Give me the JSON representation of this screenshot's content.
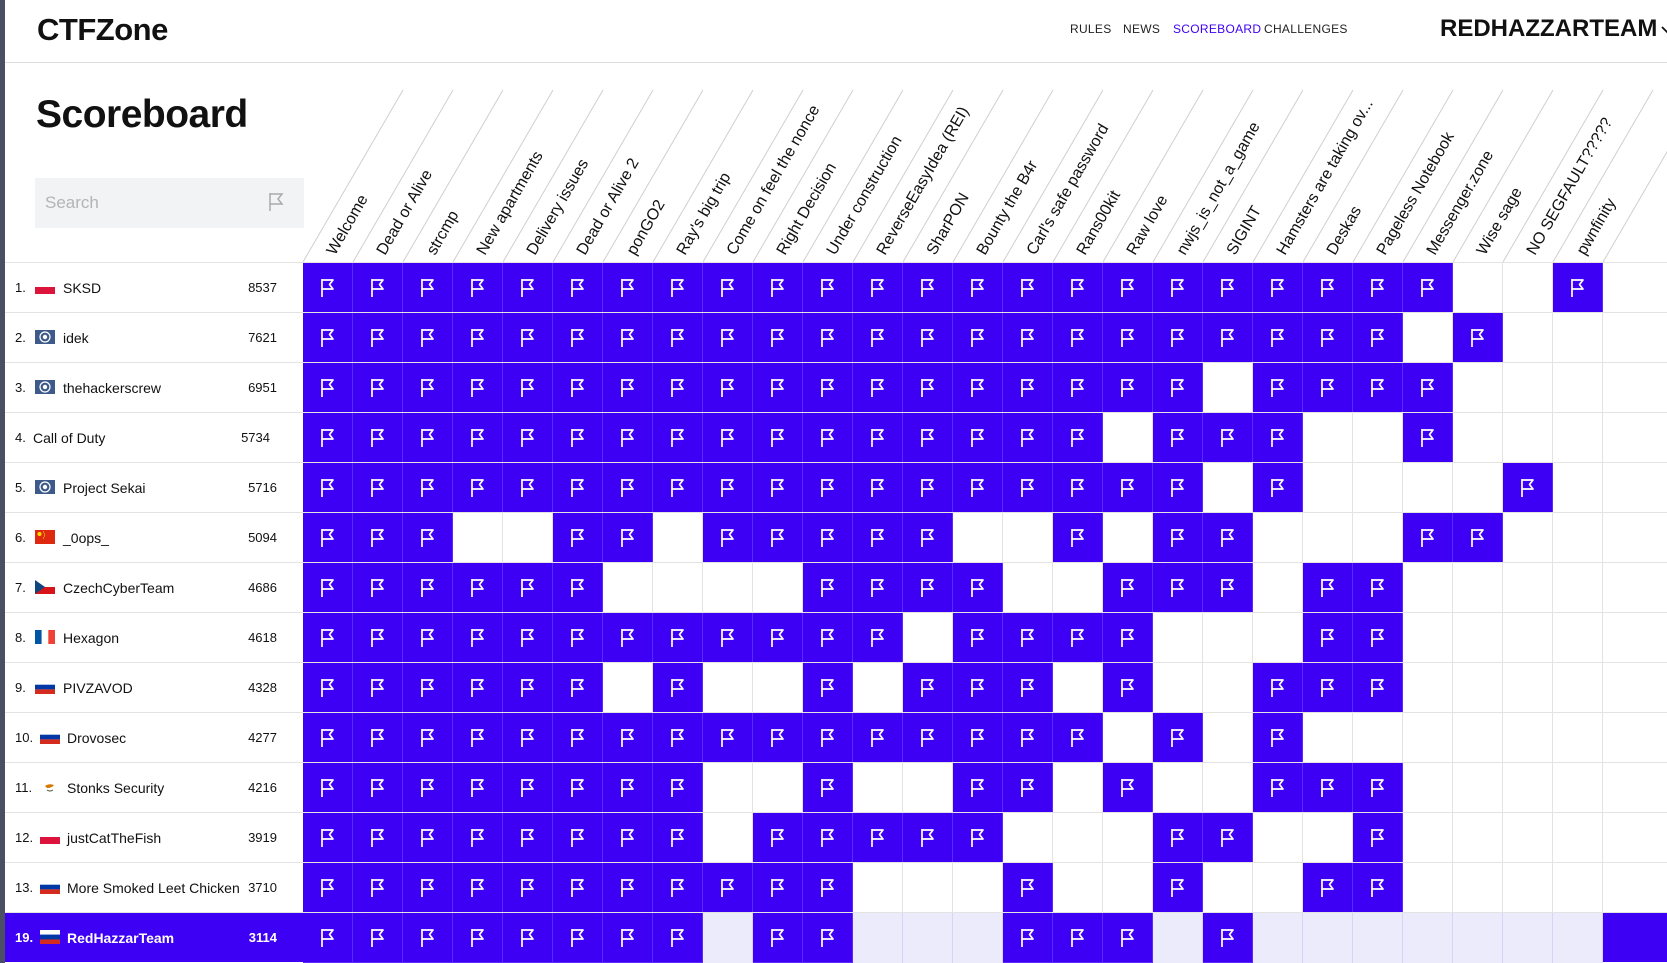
{
  "app": {
    "logo": "CTFZone"
  },
  "nav": {
    "links": [
      "RULES",
      "NEWS",
      "SCOREBOARD",
      "CHALLENGES"
    ],
    "active": "SCOREBOARD",
    "team_menu": "REDHAZZARTEAM"
  },
  "page": {
    "title": "Scoreboard"
  },
  "search": {
    "placeholder": "Search",
    "value": "",
    "icon": "flag-icon"
  },
  "colors": {
    "accent": "#3d00f5",
    "current_row_empty": "#ecebfb"
  },
  "challenges": [
    "Welcome",
    "Dead or Alive",
    "strcmp",
    "New apartments",
    "Delivery issues",
    "Dead or Alive 2",
    "ponGO2",
    "Ray's big trip",
    "Come on feel the nonce",
    "Right Decision",
    "Under construction",
    "ReverseEasyIdea (REI)",
    "SharPON",
    "Bounty the B4r",
    "Carl's safe password",
    "Rans00kit",
    "Raw love",
    "nwjs_is_not_a_game",
    "SIGINT",
    "Hamsters are taking ov...",
    "Deskas",
    "Pageless Notebook",
    "Messenger.zone",
    "Wise sage",
    "NO SEGFAULT?????",
    "pwnfinity"
  ],
  "teams": [
    {
      "rank": "1.",
      "name": "SKSD",
      "score": "8537",
      "flag": "pl",
      "solved": "1111111111111111111111100110"
    },
    {
      "rank": "2.",
      "name": "idek",
      "score": "7621",
      "flag": "un",
      "solved": "11111111111111111111110100"
    },
    {
      "rank": "3.",
      "name": "thehackerscrew",
      "score": "6951",
      "flag": "un",
      "solved": "11111111111111111101111000"
    },
    {
      "rank": "4.",
      "name": "Call of Duty",
      "score": "5734",
      "flag": "none",
      "solved": "11111111111111110111001000"
    },
    {
      "rank": "5.",
      "name": "Project Sekai",
      "score": "5716",
      "flag": "un",
      "solved": "11111111111111111101000010"
    },
    {
      "rank": "6.",
      "name": "_0ops_",
      "score": "5094",
      "flag": "cn",
      "solved": "11100110111110010110001100"
    },
    {
      "rank": "7.",
      "name": "CzechCyberTeam",
      "score": "4686",
      "flag": "cz",
      "solved": "11111100001111001110110000"
    },
    {
      "rank": "8.",
      "name": "Hexagon",
      "score": "4618",
      "flag": "fr",
      "solved": "11111111111101111000110000"
    },
    {
      "rank": "9.",
      "name": "PIVZAVOD",
      "score": "4328",
      "flag": "ru",
      "solved": "11111101001011101001110000"
    },
    {
      "rank": "10.",
      "name": "Drovosec",
      "score": "4277",
      "flag": "ru",
      "solved": "11111111111111110101000000"
    },
    {
      "rank": "11.",
      "name": "Stonks Security",
      "score": "4216",
      "flag": "cy",
      "solved": "11111111001001101001110000"
    },
    {
      "rank": "12.",
      "name": "justCatTheFish",
      "score": "3919",
      "flag": "pl",
      "solved": "11111111011111000110010000"
    },
    {
      "rank": "13.",
      "name": "More Smoked Leet Chicken",
      "score": "3710",
      "flag": "ru",
      "solved": "11111111111000100100110000"
    },
    {
      "rank": "19.",
      "name": "RedHazzarTeam",
      "score": "3114",
      "flag": "ru",
      "solved": "11111111011000111010000000",
      "current": true
    }
  ]
}
